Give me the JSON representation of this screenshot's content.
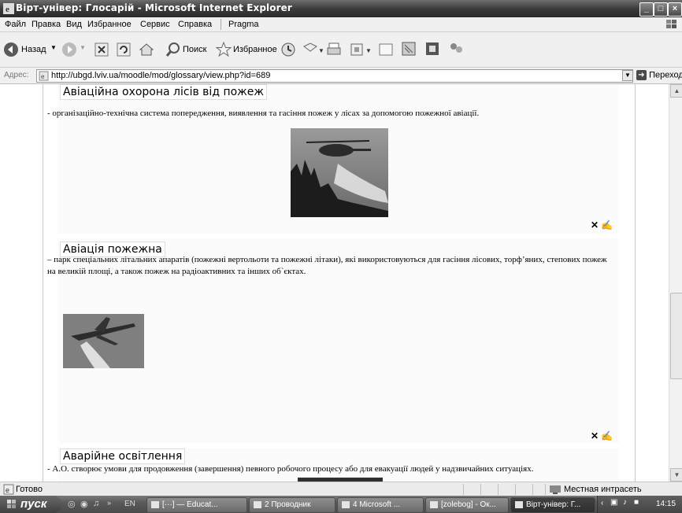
{
  "window": {
    "title": "Вірт-універ: Глосарій - Microsoft Internet Explorer",
    "controls": [
      "minimize",
      "maximize",
      "close"
    ]
  },
  "menu": {
    "items": [
      "Файл",
      "Правка",
      "Вид",
      "Избранное",
      "Сервис",
      "Справка"
    ],
    "extra": "Pragma"
  },
  "toolbar": {
    "back_label": "Назад",
    "search_label": "Поиск",
    "favorites_label": "Избранное"
  },
  "address": {
    "label": "Адрес:",
    "url": "http://ubgd.lviv.ua/moodle/mod/glossary/view.php?id=689",
    "go_label": "Переход"
  },
  "entries": [
    {
      "term": "Авіаційна охорона лісів від пожеж",
      "definition": "- організаційно-технічна система  попередження, виявлення та гасіння пожеж у лісах за допомогою  пожежної авіації.",
      "image": "helicopter-dropping-water-photo",
      "actions": [
        "delete",
        "edit"
      ]
    },
    {
      "term": "Авіація пожежна",
      "definition": "– парк спеціальних літальних апаратів (пожежні вертольоти та пожежні літаки), які використовуються для гасіння лісових, торф’яних, степових пожеж на великій площі, а також пожеж на радіоактивних та інших об`єктах.",
      "image": "firefighting-plane-photo",
      "actions": [
        "delete",
        "edit"
      ]
    },
    {
      "term": "Аварійне освітлення",
      "definition": " - А.О. створює умови для продовження (завершення) певного робочого процесу або  для евакуації людей  у надзвичайних ситуаціях.",
      "image": "emergency-lighting-photo"
    }
  ],
  "status": {
    "text": "Готово",
    "zone": "Местная интрасеть"
  },
  "taskbar": {
    "start_label": "пуск",
    "lang": "EN",
    "tasks": [
      {
        "label": "[···] — Educat...",
        "active": false
      },
      {
        "label": "2 Проводник",
        "active": false
      },
      {
        "label": "4 Microsoft ...",
        "active": false
      },
      {
        "label": "[zolebog] - Ок...",
        "active": false
      },
      {
        "label": "Вірт-універ: Г...",
        "active": true
      }
    ],
    "clock": "14:15"
  },
  "colors": {
    "titlebar": "#3c3c3c",
    "chrome": "#f0f0f0",
    "taskbar": "#5a5a5a"
  }
}
